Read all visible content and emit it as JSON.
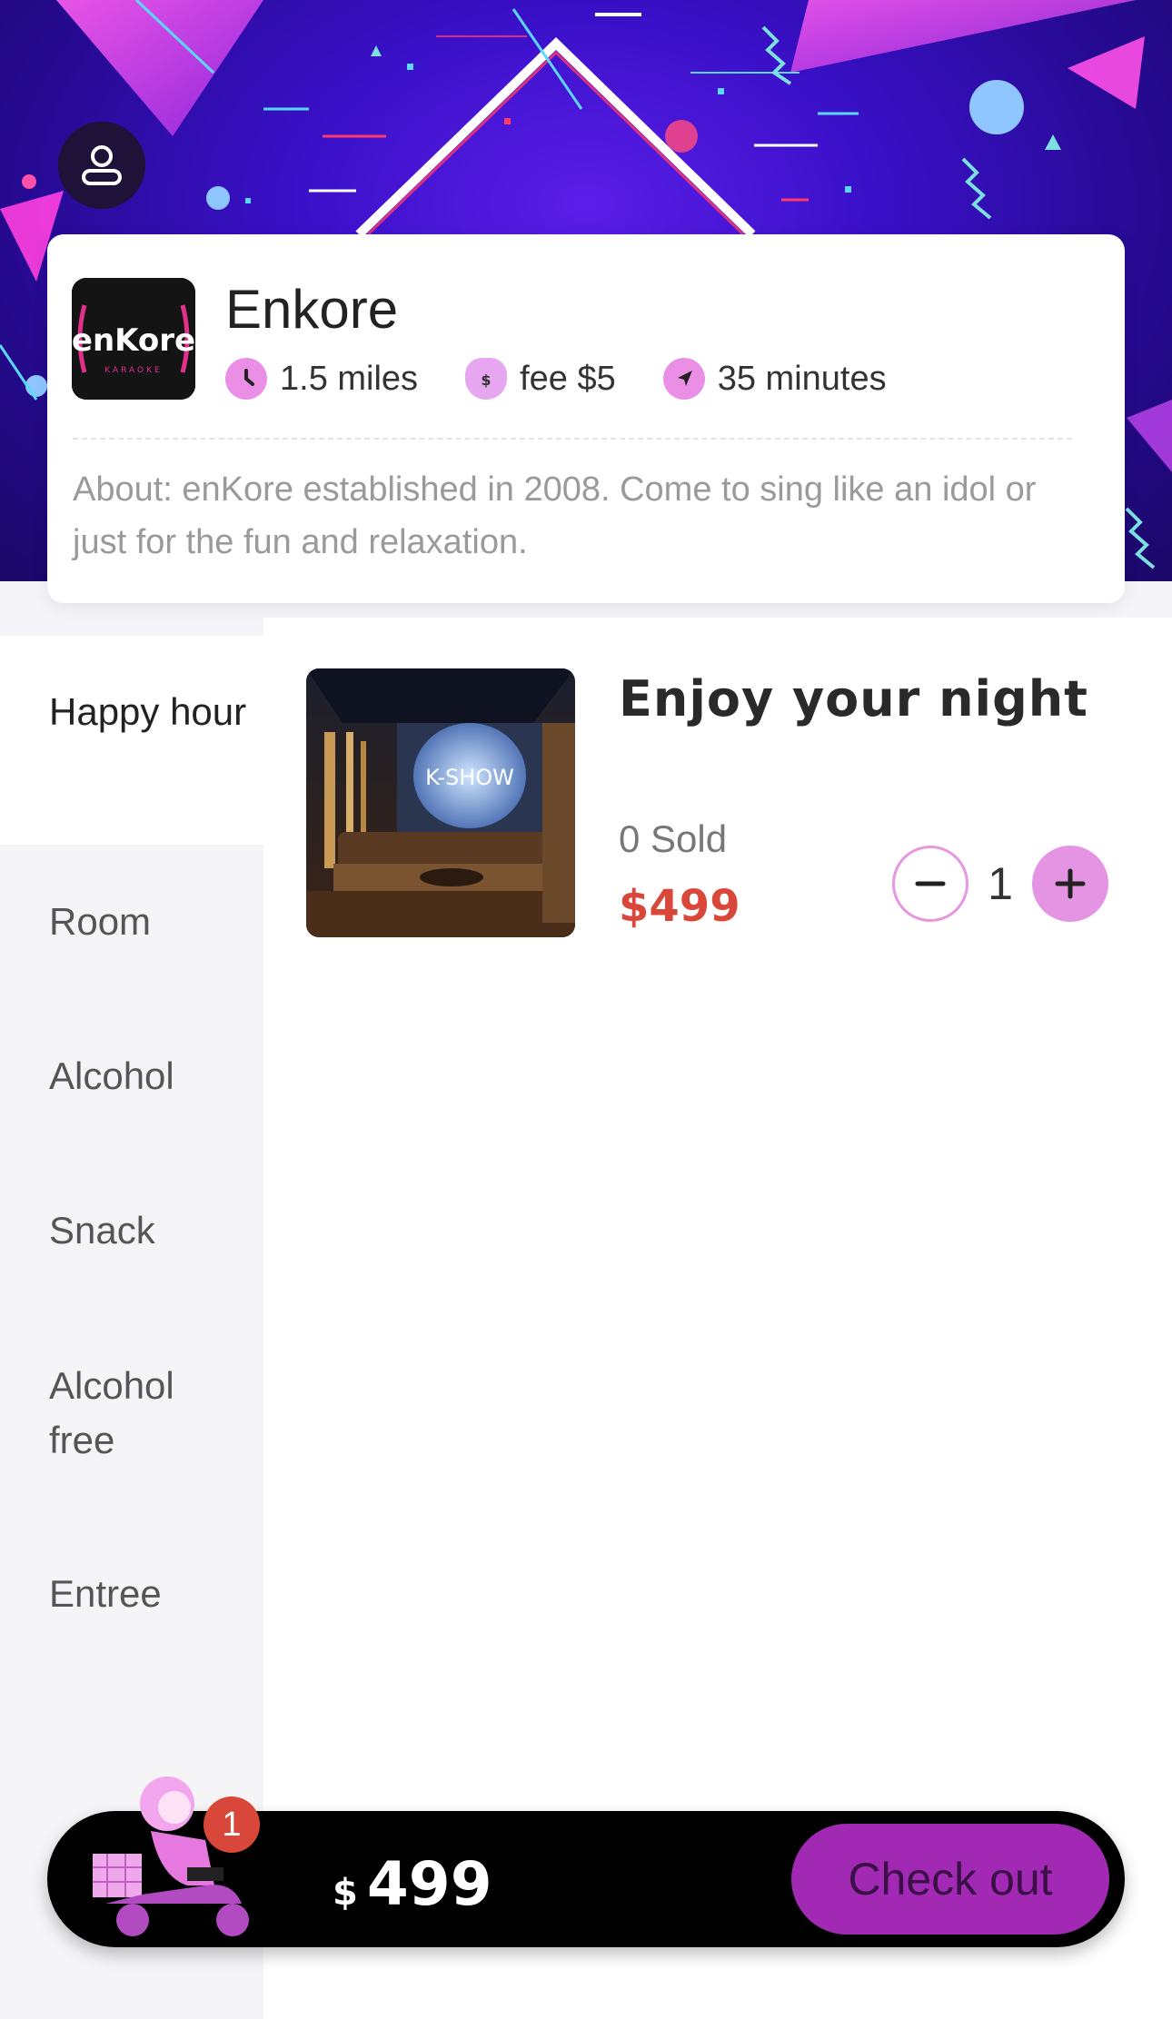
{
  "store": {
    "name": "Enkore",
    "logo_text": "enKore",
    "logo_subtext": "KARAOKE",
    "distance": "1.5 miles",
    "fee": "fee $5",
    "time": "35 minutes",
    "about": "About: enKore established in 2008. Come to sing like an idol or just for the fun and relaxation."
  },
  "categories": [
    {
      "label": "Happy hour",
      "active": true
    },
    {
      "label": "Room",
      "active": false
    },
    {
      "label": "Alcohol",
      "active": false
    },
    {
      "label": "Snack",
      "active": false
    },
    {
      "label": "Alcohol free",
      "active": false
    },
    {
      "label": "Entree",
      "active": false
    }
  ],
  "product": {
    "title": "Enjoy your night",
    "sold": "0 Sold",
    "price": "$499",
    "quantity": "1",
    "image_sign": "K-SHOW"
  },
  "cart": {
    "badge": "1",
    "currency": "$",
    "amount": "499",
    "checkout_label": "Check out"
  },
  "colors": {
    "accent_pink": "#e594e3",
    "price_red": "#d9473a",
    "checkout_purple": "#a229b4",
    "banner_purple": "#3a10c8"
  }
}
